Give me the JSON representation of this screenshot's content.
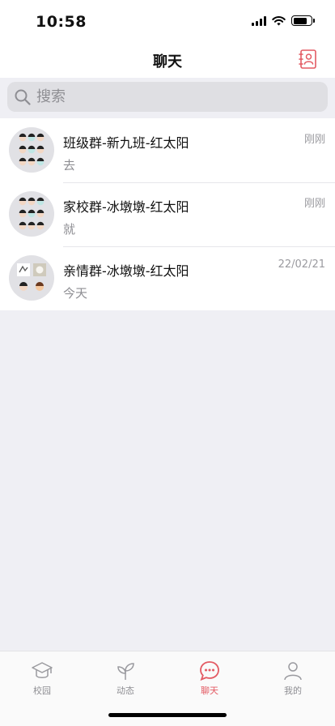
{
  "status_bar": {
    "time": "10:58"
  },
  "nav": {
    "title": "聊天",
    "contacts_icon": "contacts-book-icon"
  },
  "search": {
    "placeholder": "搜索"
  },
  "chats": [
    {
      "name": "班级群-新九班-红太阳",
      "preview": "去",
      "time": "刚刚"
    },
    {
      "name": "家校群-冰墩墩-红太阳",
      "preview": "就",
      "time": "刚刚"
    },
    {
      "name": "亲情群-冰墩墩-红太阳",
      "preview": "今天",
      "time": "22/02/21"
    }
  ],
  "tabs": [
    {
      "label": "校园",
      "icon": "graduation-cap-icon",
      "active": false
    },
    {
      "label": "动态",
      "icon": "sprout-icon",
      "active": false
    },
    {
      "label": "聊天",
      "icon": "chat-bubble-icon",
      "active": true
    },
    {
      "label": "我的",
      "icon": "person-icon",
      "active": false
    }
  ],
  "colors": {
    "accent": "#e35a63",
    "background": "#efeff4",
    "muted": "#8e8e93"
  }
}
